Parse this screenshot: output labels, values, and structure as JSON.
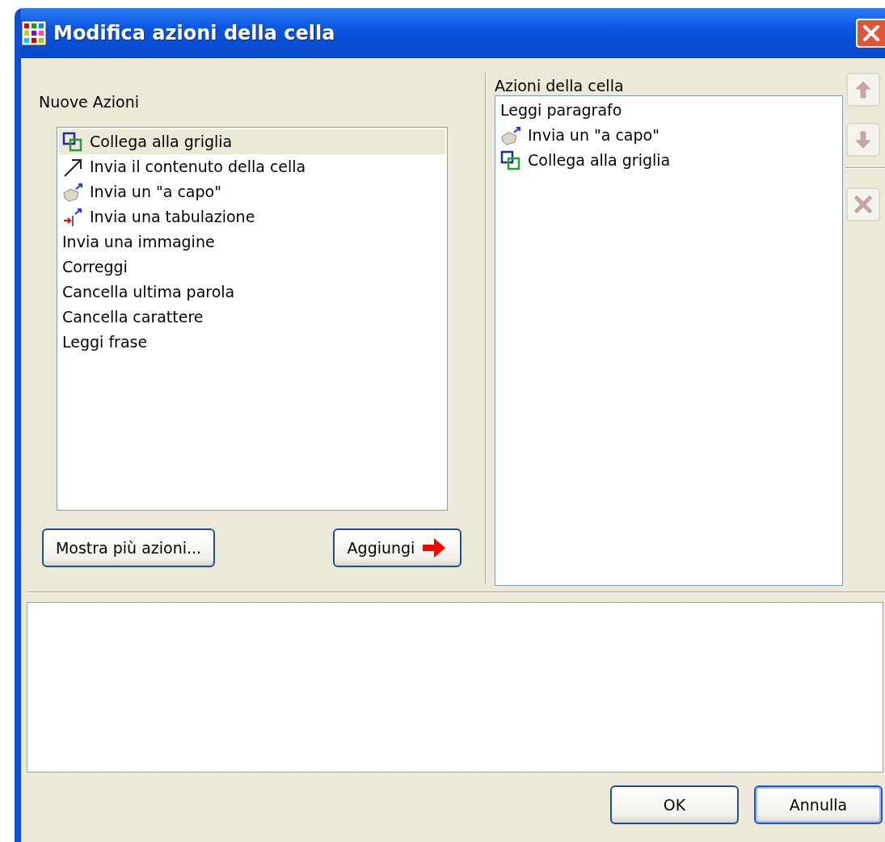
{
  "window": {
    "title": "Modifica azioni della cella"
  },
  "new_actions": {
    "label": "Nuove Azioni",
    "items": [
      {
        "label": "Collega alla griglia",
        "kind": "link",
        "selected": true
      },
      {
        "label": "Invia il contenuto della cella",
        "kind": "arrow",
        "selected": false
      },
      {
        "label": "Invia un \"a capo\"",
        "kind": "newline",
        "selected": false
      },
      {
        "label": "Invia una tabulazione",
        "kind": "tab",
        "selected": false
      },
      {
        "label": "Invia una immagine",
        "kind": "text",
        "selected": false
      },
      {
        "label": "Correggi",
        "kind": "text",
        "selected": false
      },
      {
        "label": "Cancella ultima parola",
        "kind": "text",
        "selected": false
      },
      {
        "label": "Cancella carattere",
        "kind": "text",
        "selected": false
      },
      {
        "label": "Leggi frase",
        "kind": "text",
        "selected": false
      }
    ]
  },
  "more_button": {
    "label": "Mostra più azioni..."
  },
  "add_button": {
    "label": "Aggiungi"
  },
  "cell_actions": {
    "label": "Azioni della cella",
    "items": [
      {
        "label": "Leggi paragrafo",
        "kind": "text",
        "selected": false
      },
      {
        "label": "Invia un \"a capo\"",
        "kind": "newline",
        "selected": false
      },
      {
        "label": "Collega alla griglia",
        "kind": "link",
        "selected": false
      }
    ]
  },
  "side_buttons": [
    {
      "kind": "up",
      "disabled": true
    },
    {
      "kind": "down",
      "disabled": true
    },
    {
      "kind": "delete",
      "disabled": true
    }
  ],
  "buttons": [
    {
      "label": "OK",
      "default": false
    },
    {
      "label": "Annulla",
      "default": true
    }
  ]
}
